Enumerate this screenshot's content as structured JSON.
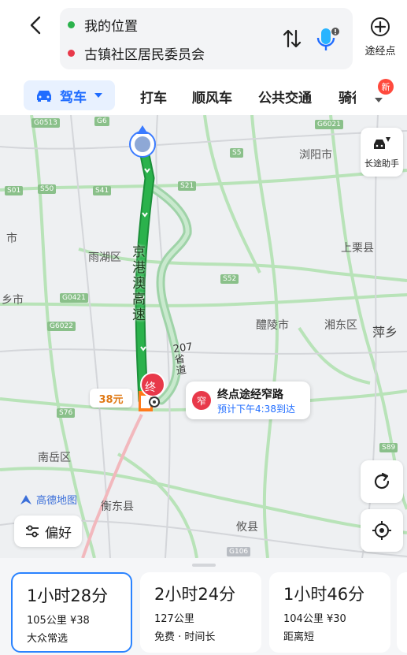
{
  "header": {
    "origin": "我的位置",
    "destination": "古镇社区居民委员会",
    "via_label": "途经点"
  },
  "tabs": {
    "active": "驾车",
    "items": [
      "打车",
      "顺风车",
      "公共交通",
      "骑行"
    ],
    "badge": "新"
  },
  "map": {
    "places": [
      "浏阳市",
      "雨湖区",
      "上栗县",
      "醴陵市",
      "湘东区",
      "萍乡",
      "南岳区",
      "衡东县",
      "攸县",
      "市",
      "乡市"
    ],
    "shields": [
      "G6021",
      "S01",
      "S50",
      "S41",
      "S21",
      "S52",
      "G0421",
      "G6022",
      "S76",
      "S89",
      "G106",
      "G0513",
      "S5",
      "G6"
    ],
    "road_labels": {
      "expressway": "京港澳高速",
      "provincial": "207省道"
    },
    "toll": "38元",
    "end_marker": "终",
    "callout": {
      "badge": "窄",
      "title": "终点途经窄路",
      "subtitle": "预计下午4:38到达"
    },
    "long_trip_label": "长途助手",
    "logo_text": "高德地图",
    "preference_label": "偏好"
  },
  "routes": [
    {
      "time": "1小时28分",
      "meta": "105公里 ¥38",
      "tag": "大众常选"
    },
    {
      "time": "2小时24分",
      "meta": "127公里",
      "tag": "免费 · 时间长"
    },
    {
      "time": "1小时46分",
      "meta": "104公里 ¥30",
      "tag": "距离短"
    }
  ],
  "colors": {
    "accent": "#1f6cff",
    "route_main": "#2bb24c",
    "route_alt": "#9fd3a8",
    "origin_dot": "#2bb24c",
    "dest_dot": "#e8394a",
    "end_marker": "#ff7a1a"
  }
}
